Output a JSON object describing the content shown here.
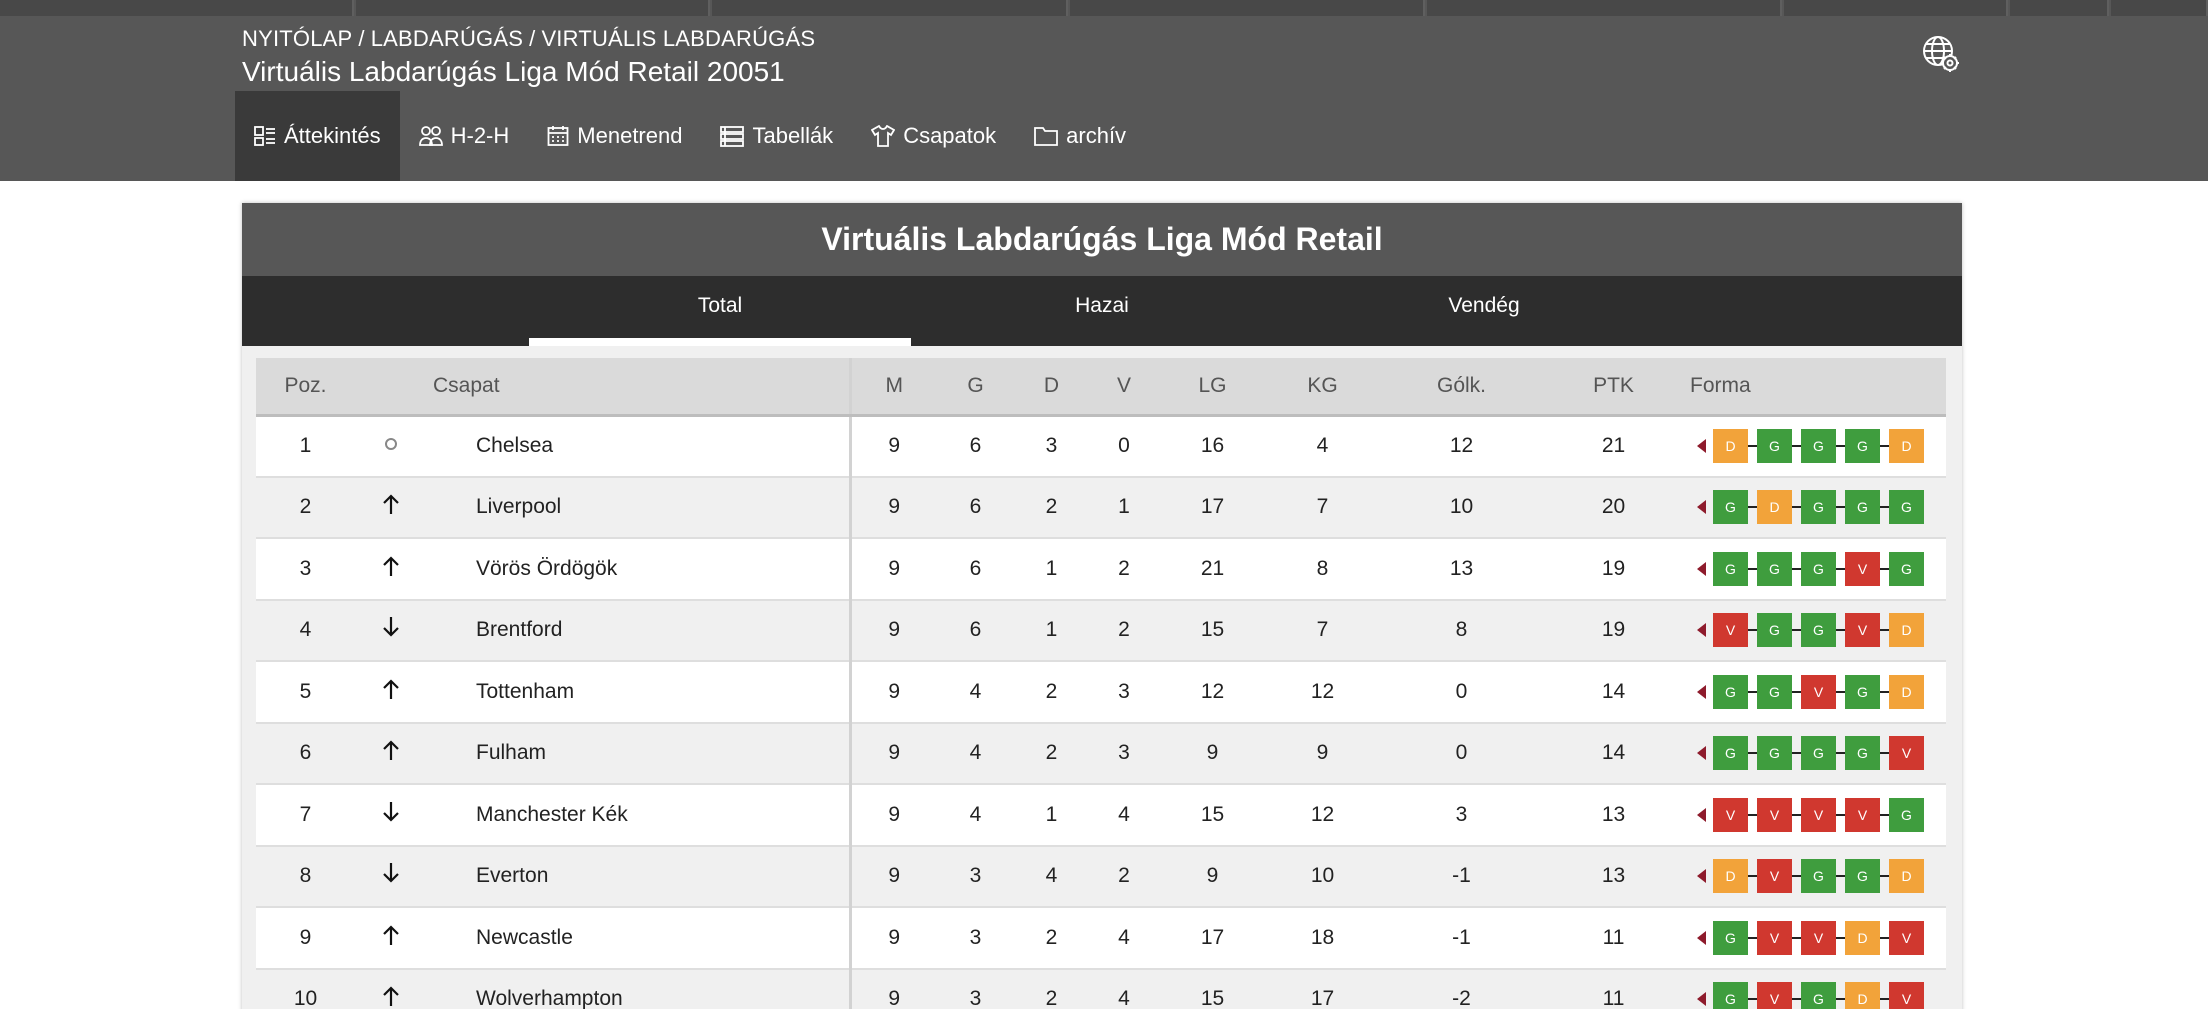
{
  "breadcrumb": [
    "NYITÓLAP",
    "LABDARÚGÁS",
    "VIRTUÁLIS LABDARÚGÁS"
  ],
  "page_title": "Virtuális Labdarúgás Liga Mód Retail 20051",
  "nav": [
    {
      "label": "Áttekintés",
      "icon": "overview-icon",
      "active": true
    },
    {
      "label": "H-2-H",
      "icon": "head-to-head-icon",
      "active": false
    },
    {
      "label": "Menetrend",
      "icon": "calendar-icon",
      "active": false
    },
    {
      "label": "Tabellák",
      "icon": "tables-icon",
      "active": false
    },
    {
      "label": "Csapatok",
      "icon": "jersey-icon",
      "active": false
    },
    {
      "label": "archív",
      "icon": "folder-icon",
      "active": false
    }
  ],
  "card_title": "Virtuális Labdarúgás Liga Mód Retail",
  "tabs": [
    {
      "label": "Total",
      "active": true
    },
    {
      "label": "Hazai",
      "active": false
    },
    {
      "label": "Vendég",
      "active": false
    }
  ],
  "columns": {
    "pos": "Poz.",
    "team": "Csapat",
    "m": "M",
    "g": "G",
    "d": "D",
    "v": "V",
    "lg": "LG",
    "kg": "KG",
    "gd": "Gólk.",
    "ptk": "PTK",
    "form": "Forma"
  },
  "rows": [
    {
      "pos": "1",
      "trend": "same",
      "team": "Chelsea",
      "m": "9",
      "g": "6",
      "d": "3",
      "v": "0",
      "lg": "16",
      "kg": "4",
      "gd": "12",
      "ptk": "21",
      "form": [
        "D",
        "G",
        "G",
        "G",
        "D"
      ]
    },
    {
      "pos": "2",
      "trend": "up",
      "team": "Liverpool",
      "m": "9",
      "g": "6",
      "d": "2",
      "v": "1",
      "lg": "17",
      "kg": "7",
      "gd": "10",
      "ptk": "20",
      "form": [
        "G",
        "D",
        "G",
        "G",
        "G"
      ]
    },
    {
      "pos": "3",
      "trend": "up",
      "team": "Vörös Ördögök",
      "m": "9",
      "g": "6",
      "d": "1",
      "v": "2",
      "lg": "21",
      "kg": "8",
      "gd": "13",
      "ptk": "19",
      "form": [
        "G",
        "G",
        "G",
        "V",
        "G"
      ]
    },
    {
      "pos": "4",
      "trend": "down",
      "team": "Brentford",
      "m": "9",
      "g": "6",
      "d": "1",
      "v": "2",
      "lg": "15",
      "kg": "7",
      "gd": "8",
      "ptk": "19",
      "form": [
        "V",
        "G",
        "G",
        "V",
        "D"
      ]
    },
    {
      "pos": "5",
      "trend": "up",
      "team": "Tottenham",
      "m": "9",
      "g": "4",
      "d": "2",
      "v": "3",
      "lg": "12",
      "kg": "12",
      "gd": "0",
      "ptk": "14",
      "form": [
        "G",
        "G",
        "V",
        "G",
        "D"
      ]
    },
    {
      "pos": "6",
      "trend": "up",
      "team": "Fulham",
      "m": "9",
      "g": "4",
      "d": "2",
      "v": "3",
      "lg": "9",
      "kg": "9",
      "gd": "0",
      "ptk": "14",
      "form": [
        "G",
        "G",
        "G",
        "G",
        "V"
      ]
    },
    {
      "pos": "7",
      "trend": "down",
      "team": "Manchester Kék",
      "m": "9",
      "g": "4",
      "d": "1",
      "v": "4",
      "lg": "15",
      "kg": "12",
      "gd": "3",
      "ptk": "13",
      "form": [
        "V",
        "V",
        "V",
        "V",
        "G"
      ]
    },
    {
      "pos": "8",
      "trend": "down",
      "team": "Everton",
      "m": "9",
      "g": "3",
      "d": "4",
      "v": "2",
      "lg": "9",
      "kg": "10",
      "gd": "-1",
      "ptk": "13",
      "form": [
        "D",
        "V",
        "G",
        "G",
        "D"
      ]
    },
    {
      "pos": "9",
      "trend": "up",
      "team": "Newcastle",
      "m": "9",
      "g": "3",
      "d": "2",
      "v": "4",
      "lg": "17",
      "kg": "18",
      "gd": "-1",
      "ptk": "11",
      "form": [
        "G",
        "V",
        "V",
        "D",
        "V"
      ]
    },
    {
      "pos": "10",
      "trend": "up",
      "team": "Wolverhampton",
      "m": "9",
      "g": "3",
      "d": "2",
      "v": "4",
      "lg": "15",
      "kg": "17",
      "gd": "-2",
      "ptk": "11",
      "form": [
        "G",
        "V",
        "G",
        "D",
        "V"
      ]
    }
  ],
  "colors": {
    "win": "#3f9d3e",
    "draw": "#f2a33a",
    "loss": "#d0382f",
    "header_bg": "#575757",
    "tabs_bg": "#2d2d2d"
  }
}
